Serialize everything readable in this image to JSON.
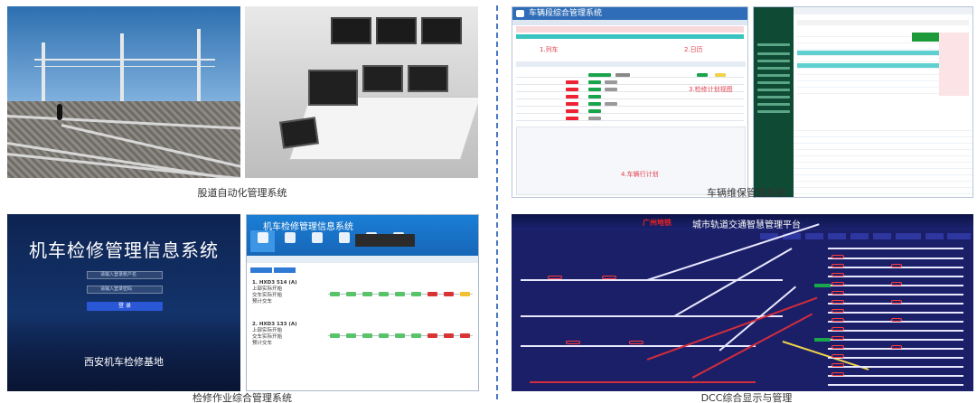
{
  "panels": {
    "track": {
      "caption": "股道自动化管理系统"
    },
    "vehicle": {
      "caption": "车辆维保管理系统",
      "window_title": "车辆段综合管理系统",
      "area_labels": [
        "1.列车",
        "2.日历",
        "3.检修计划视图",
        "4.车辆行计划"
      ]
    },
    "loco": {
      "caption": "检修作业综合管理系统",
      "login_title": "机车检修管理信息系统",
      "login_base": "西安机车检修基地",
      "login_user_placeholder": "请输入登录账户名",
      "login_pass_placeholder": "请输入登录密码",
      "login_button": "登 录",
      "app_title": "机车检修管理信息系统",
      "task1": [
        "1. HXD3 514 (A)",
        "上部实际开始",
        "交车实际开始",
        "预计交车"
      ],
      "task2": [
        "2. HXD3 133 (A)",
        "上部实际开始",
        "交车实际开始",
        "预计交车"
      ]
    },
    "dcc": {
      "caption": "DCC综合显示与管理",
      "brand": "广州地铁",
      "title": "城市轨道交通智慧管理平台"
    }
  },
  "colors": {
    "divider": "#4a78c8",
    "vehicle_blue": "#2f6db8",
    "vehicle_green": "#0f4a35",
    "loco_blue": "#1766b7",
    "dcc_bg": "#1b1f68",
    "track_red": "#d32d3c"
  }
}
